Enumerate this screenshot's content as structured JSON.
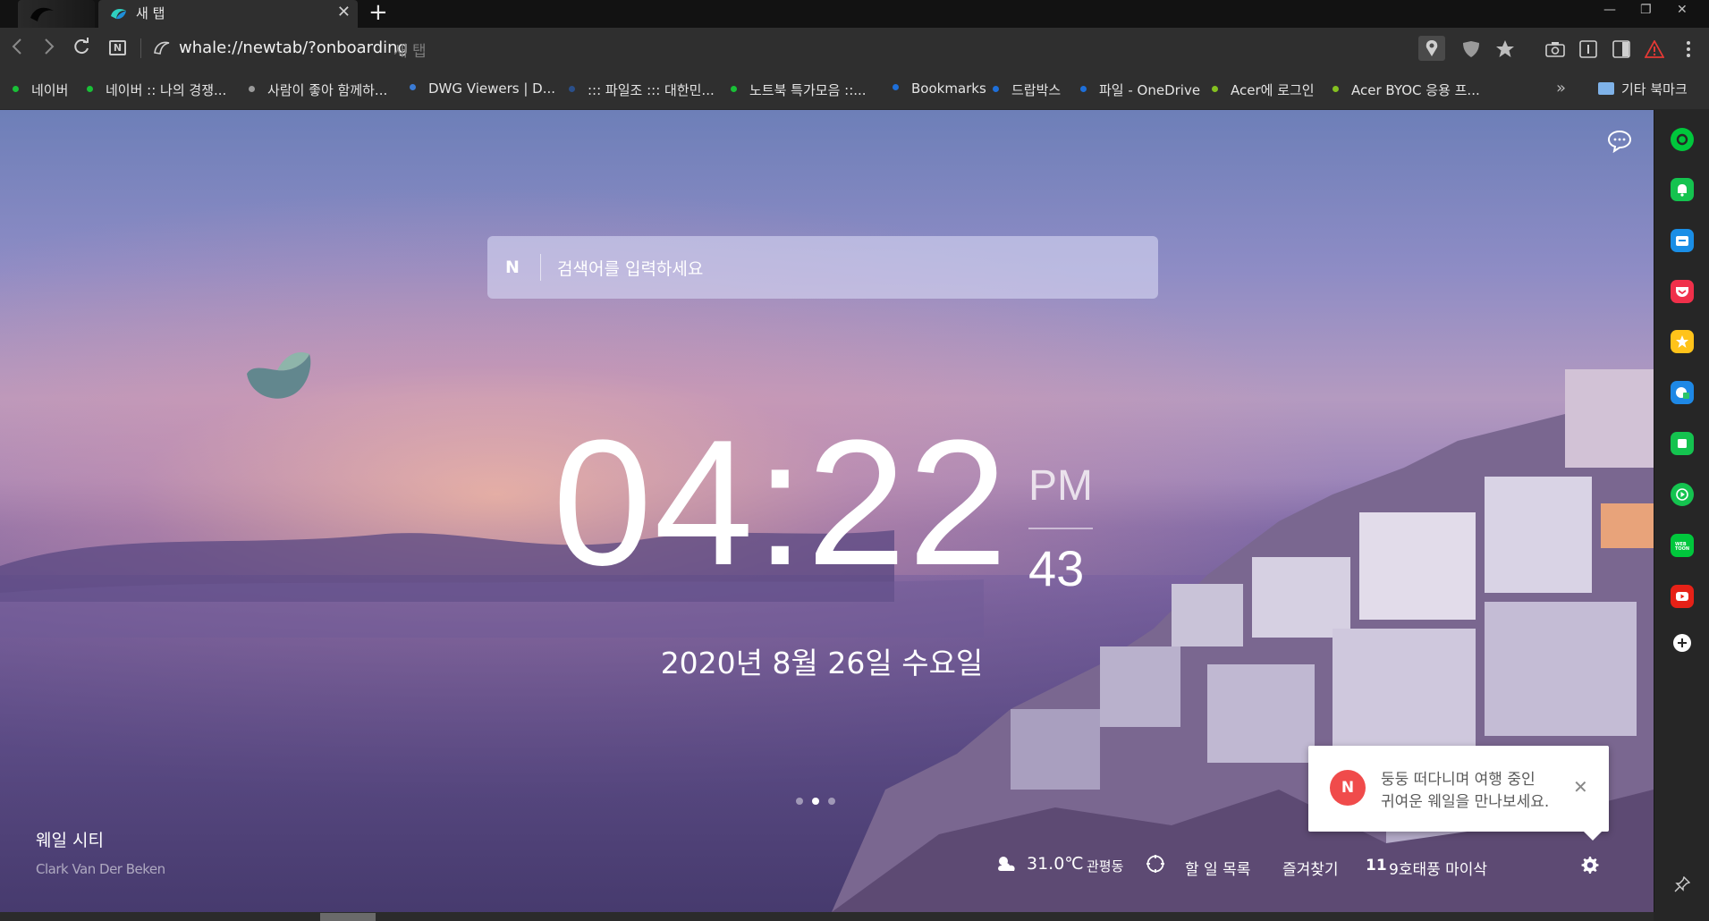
{
  "tab": {
    "title": "새 탭"
  },
  "address": {
    "url": "whale://newtab/?onboarding",
    "hint": "새 탭"
  },
  "bookmarks": [
    {
      "label": "네이버",
      "color": "#19c037"
    },
    {
      "label": "네이버 :: 나의 경쟁...",
      "color": "#19c037"
    },
    {
      "label": "사람이 좋아 함께하...",
      "color": "#9a9a9a"
    },
    {
      "label": "DWG Viewers | D...",
      "color": "#3a7bd5"
    },
    {
      "label": "::: 파일조 ::: 대한민...",
      "color": "#2a4f8a"
    },
    {
      "label": "노트북 특가모음 ::...",
      "color": "#19c037"
    },
    {
      "label": "Bookmarks",
      "color": "#1e6fd9"
    },
    {
      "label": "드랍박스",
      "color": "#1e6fd9"
    },
    {
      "label": "파일 - OneDrive",
      "color": "#1e6fd9"
    },
    {
      "label": "Acer에 로그인",
      "color": "#84c020"
    },
    {
      "label": "Acer BYOC 응용 프...",
      "color": "#84c020"
    }
  ],
  "bookmarks_other": "기타 북마크",
  "search": {
    "placeholder": "검색어를 입력하세요",
    "logo": "N"
  },
  "clock": {
    "hm": "04:22",
    "ampm": "PM",
    "seconds": "43"
  },
  "date": "2020년 8월 26일 수요일",
  "credit": {
    "title": "웨일 시티",
    "author": "Clark Van Der Beken"
  },
  "toast": {
    "badge": "N",
    "line1": "둥둥 떠다니며 여행 중인",
    "line2": "귀여운 웨일을 만나보세요."
  },
  "bottom": {
    "temperature": "31.0℃",
    "location": "관평동",
    "todo": "할 일 목록",
    "favorites": "즐겨찾기",
    "news_num": "11",
    "news_text": "9호태풍 마이삭"
  },
  "slide_dots": {
    "count": 3,
    "active": 2
  },
  "colors": {
    "accent_green": "#00c73c",
    "toast_badge": "#f04b4b"
  }
}
